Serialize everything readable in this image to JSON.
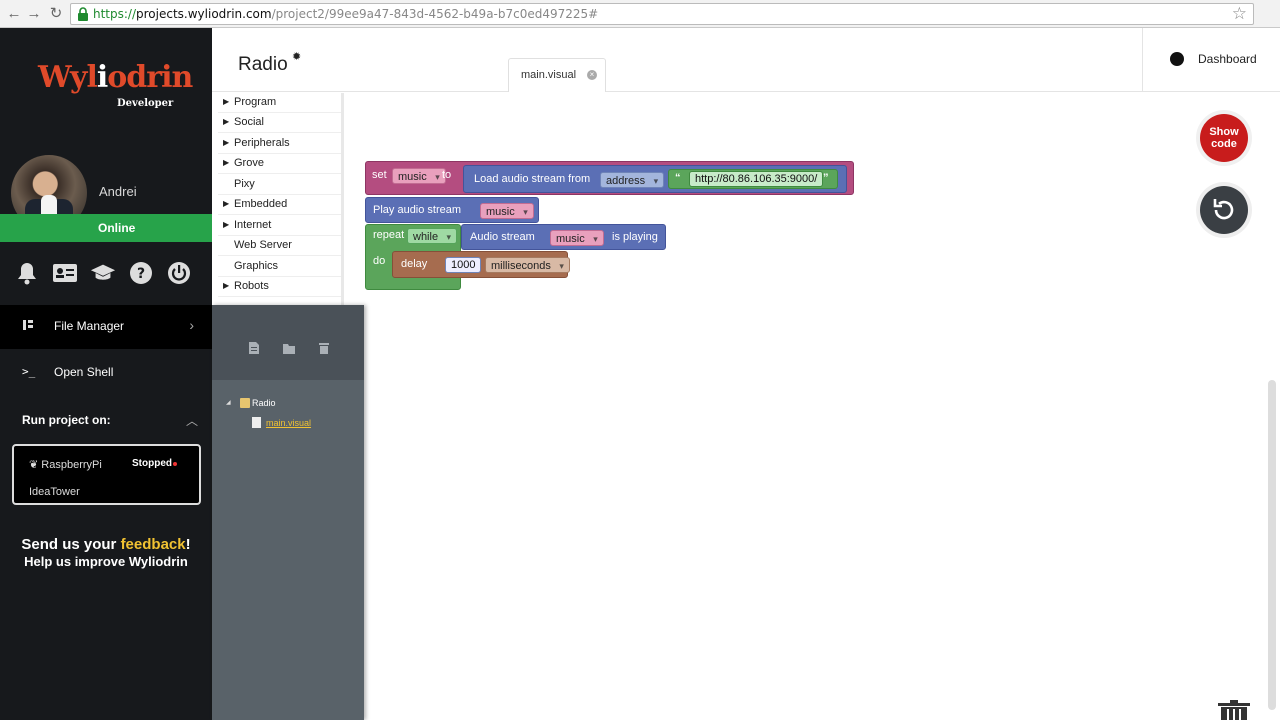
{
  "browser": {
    "url_scheme": "https://",
    "url_host": "projects.wyliodrin.com",
    "url_path": "/project2/99ee9a47-843d-4562-b49a-b7c0ed497225#"
  },
  "sidebar": {
    "logo_prefix": "Wyl",
    "logo_i": "i",
    "logo_suffix": "odrin",
    "logo_sub": "Developer",
    "username": "Andrei",
    "status": "Online",
    "menu": {
      "file_manager": "File Manager",
      "open_shell": "Open Shell"
    },
    "run_on_label": "Run project on:",
    "device": {
      "name": "RaspberryPi",
      "status": "Stopped",
      "tower": "IdeaTower"
    },
    "feedback": {
      "pre": "Send us your ",
      "accent": "feedback",
      "post": "!",
      "line2": "Help us improve Wyliodrin"
    }
  },
  "header": {
    "project_title": "Radio",
    "tab_label": "main.visual",
    "dashboard_label": "Dashboard"
  },
  "toolbox": {
    "items": [
      {
        "label": "Program",
        "has_children": true
      },
      {
        "label": "Social",
        "has_children": true
      },
      {
        "label": "Peripherals",
        "has_children": true
      },
      {
        "label": "Grove",
        "has_children": true
      },
      {
        "label": "Pixy",
        "has_children": false
      },
      {
        "label": "Embedded",
        "has_children": true
      },
      {
        "label": "Internet",
        "has_children": true
      },
      {
        "label": "Web Server",
        "has_children": false
      },
      {
        "label": "Graphics",
        "has_children": false
      },
      {
        "label": "Robots",
        "has_children": true
      }
    ]
  },
  "file_tree": {
    "root": "Radio",
    "child": "main.visual"
  },
  "blocks": {
    "set": {
      "kw": "set",
      "var": "music",
      "to": "to"
    },
    "load": {
      "label": "Load audio  stream from",
      "mode": "address",
      "url": "http://80.86.106.35:9000/"
    },
    "play": {
      "label": "Play audio stream",
      "var": "music"
    },
    "repeat": {
      "kw": "repeat",
      "mode": "while",
      "do": "do"
    },
    "audio_stream": {
      "label": "Audio stream",
      "var": "music",
      "suffix": "is playing"
    },
    "delay": {
      "label": "delay",
      "value": "1000",
      "unit": "milliseconds"
    }
  },
  "buttons": {
    "show_code_line1": "Show",
    "show_code_line2": "code"
  },
  "colors": {
    "brand_red": "#e04a2a",
    "online_green": "#27a34a",
    "show_code_red": "#c81c1c",
    "block_pink": "#b44d80",
    "block_blue": "#5b6fb5",
    "block_green": "#5ba55b",
    "block_brown": "#a66c4f"
  }
}
